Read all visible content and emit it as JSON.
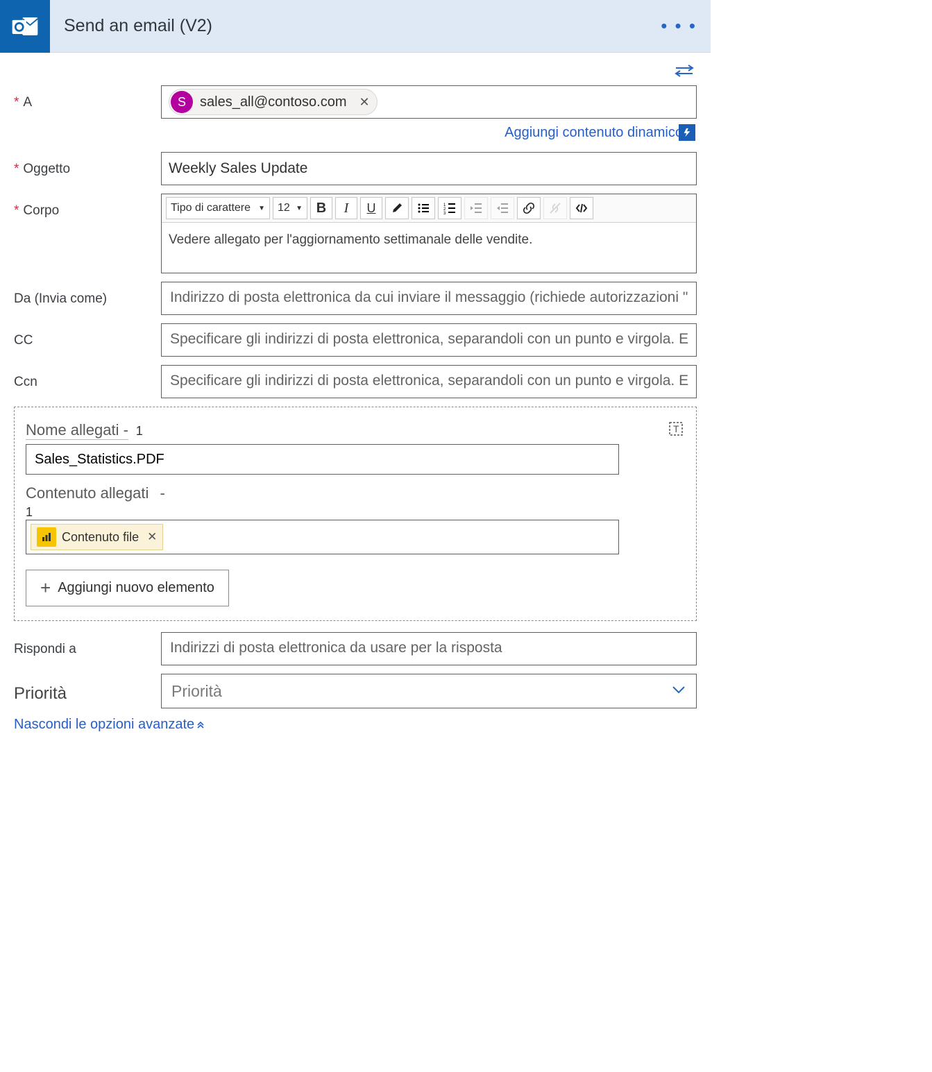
{
  "header": {
    "title": "Send an email (V2)"
  },
  "labels": {
    "to": "A",
    "subject": "Oggetto",
    "body": "Corpo",
    "from": "Da (Invia come)",
    "cc": "CC",
    "bcc": "Ccn",
    "attachmentsName": "Nome allegati -",
    "attachmentsContent": "Contenuto allegati",
    "replyTo": "Rispondi a",
    "priority": "Priorità"
  },
  "recipient": {
    "initial": "S",
    "email": "sales_all@contoso.com"
  },
  "dynamic_link": "Aggiungi contenuto dinamico",
  "subject_value": "Weekly Sales Update",
  "editor": {
    "font_label": "Tipo di carattere",
    "size_label": "12",
    "body_text": "Vedere allegato per l'aggiornamento settimanale delle vendite."
  },
  "placeholders": {
    "from": "Indirizzo di posta elettronica da cui inviare il messaggio (richiede autorizzazioni \"",
    "cc": "Specificare gli indirizzi di posta elettronica, separandoli con un punto e virgola. E",
    "bcc": "Specificare gli indirizzi di posta elettronica, separandoli con un punto e virgola. E",
    "replyTo": "Indirizzi di posta elettronica da usare per la risposta",
    "priority": "Priorità"
  },
  "attachment": {
    "seq_name": "1",
    "name_value": "Sales_Statistics.PDF",
    "content_minus": "-",
    "seq_content": "1",
    "token_label": "Contenuto file",
    "add_button": "Aggiungi nuovo elemento"
  },
  "hide_advanced": "Nascondi le opzioni avanzate"
}
